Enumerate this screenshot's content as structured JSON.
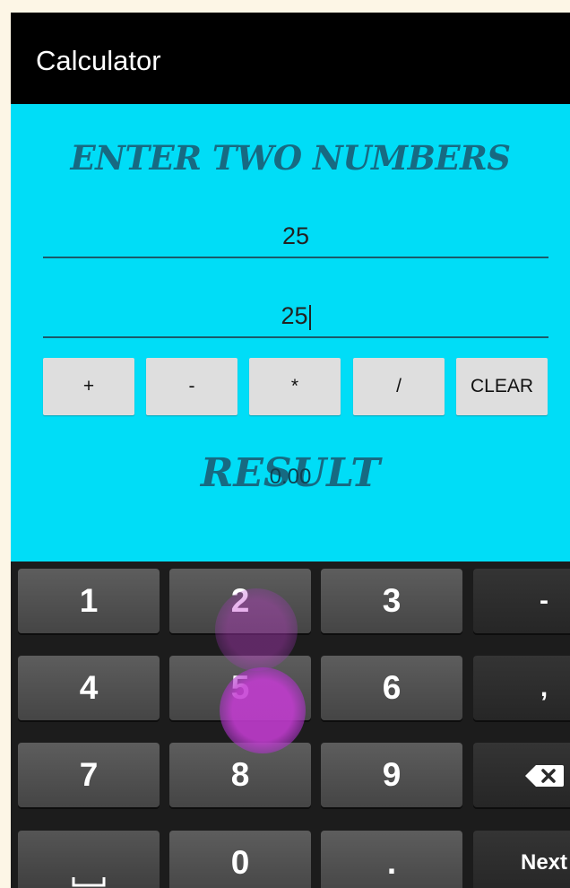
{
  "app": {
    "title": "Calculator"
  },
  "form": {
    "heading": "ENTER TWO NUMBERS",
    "first_number": "25",
    "second_number": "25"
  },
  "operators": {
    "add": "+",
    "subtract": "-",
    "multiply": "*",
    "divide": "/",
    "clear": "CLEAR"
  },
  "result": {
    "heading": "RESULT",
    "value": "0.00"
  },
  "keyboard": {
    "row1": [
      "1",
      "2",
      "3",
      "-"
    ],
    "row2": [
      "4",
      "5",
      "6",
      ","
    ],
    "row3": [
      "7",
      "8",
      "9"
    ],
    "row4": [
      "0",
      ".",
      "Next"
    ],
    "space_icon": "space-icon",
    "backspace_icon": "backspace-icon"
  },
  "colors": {
    "content_background": "#00ddf7",
    "heading_text": "#176a82",
    "action_bar": "#000000",
    "touch_indicator": "#c43cd2"
  }
}
